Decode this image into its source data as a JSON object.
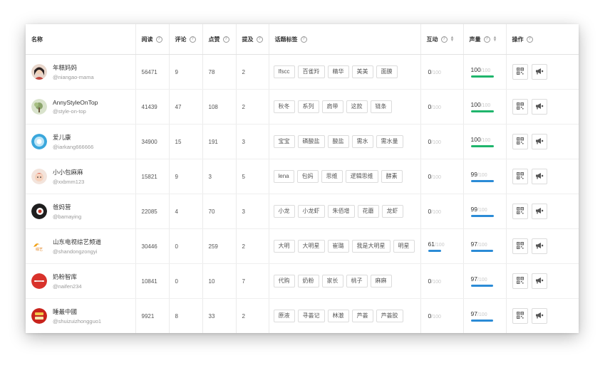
{
  "columns": {
    "name": "名称",
    "reads": "阅读",
    "comments": "评论",
    "likes": "点赞",
    "mentions": "提及",
    "topics": "话题标签",
    "interact": "互动",
    "volume": "声量",
    "actions": "操作"
  },
  "colors": {
    "green": "#1fb56c",
    "blue": "#2b8bd6",
    "help_icon": "question-circle-icon"
  },
  "rows": [
    {
      "name": "年糕妈妈",
      "handle": "@niangao-mama",
      "reads": "56471",
      "comments": "9",
      "likes": "78",
      "mentions": "2",
      "tags": [
        "lfscc",
        "百雀羚",
        "精华",
        "美美",
        "面膜"
      ],
      "interact": {
        "value": "0",
        "of": "/100",
        "fraction": 0
      },
      "volume": {
        "value": "100",
        "of": "/100",
        "fraction": 1.0,
        "color": "green"
      }
    },
    {
      "name": "AnnyStyleOnTop",
      "handle": "@style-on-top",
      "reads": "41439",
      "comments": "47",
      "likes": "108",
      "mentions": "2",
      "tags": [
        "秋冬",
        "系列",
        "肩带",
        "这款",
        "链条"
      ],
      "interact": {
        "value": "0",
        "of": "/100",
        "fraction": 0
      },
      "volume": {
        "value": "100",
        "of": "/100",
        "fraction": 1.0,
        "color": "green"
      }
    },
    {
      "name": "爱儿康",
      "handle": "@iarkang666666",
      "reads": "34900",
      "comments": "15",
      "likes": "191",
      "mentions": "3",
      "tags": [
        "宝宝",
        "磷酸盐",
        "酸盐",
        "需水",
        "需水量"
      ],
      "interact": {
        "value": "0",
        "of": "/100",
        "fraction": 0
      },
      "volume": {
        "value": "100",
        "of": "/100",
        "fraction": 1.0,
        "color": "green"
      }
    },
    {
      "name": "小小包麻麻",
      "handle": "@xxbmm123",
      "reads": "15821",
      "comments": "9",
      "likes": "3",
      "mentions": "5",
      "tags": [
        "lena",
        "包妈",
        "思维",
        "逻辑思维",
        "酵素"
      ],
      "interact": {
        "value": "0",
        "of": "/100",
        "fraction": 0
      },
      "volume": {
        "value": "99",
        "of": "/100",
        "fraction": 0.99,
        "color": "blue"
      }
    },
    {
      "name": "爸妈营",
      "handle": "@bamaying",
      "reads": "22085",
      "comments": "4",
      "likes": "70",
      "mentions": "3",
      "tags": [
        "小龙",
        "小龙虾",
        "朱佰增",
        "花蘑",
        "龙虾"
      ],
      "interact": {
        "value": "0",
        "of": "/100",
        "fraction": 0
      },
      "volume": {
        "value": "99",
        "of": "/100",
        "fraction": 0.99,
        "color": "blue"
      }
    },
    {
      "name": "山东电视综艺频道",
      "handle": "@shandongzongyi",
      "reads": "30446",
      "comments": "0",
      "likes": "259",
      "mentions": "2",
      "tags": [
        "大明",
        "大明星",
        "崔璐",
        "我是大明星",
        "明星"
      ],
      "interact": {
        "value": "61",
        "of": "/100",
        "fraction": 0.61,
        "color": "blue"
      },
      "volume": {
        "value": "97",
        "of": "/100",
        "fraction": 0.97,
        "color": "blue"
      }
    },
    {
      "name": "奶粉智库",
      "handle": "@naifen234",
      "reads": "10841",
      "comments": "0",
      "likes": "10",
      "mentions": "7",
      "tags": [
        "代购",
        "奶粉",
        "家长",
        "桃子",
        "麻麻"
      ],
      "interact": {
        "value": "0",
        "of": "/100",
        "fraction": 0
      },
      "volume": {
        "value": "97",
        "of": "/100",
        "fraction": 0.97,
        "color": "blue"
      }
    },
    {
      "name": "睡最中國",
      "handle": "@shuizuizhongguo1",
      "reads": "9921",
      "comments": "8",
      "likes": "33",
      "mentions": "2",
      "tags": [
        "原液",
        "寻荟记",
        "林澈",
        "芦荟",
        "芦荟胶"
      ],
      "interact": {
        "value": "0",
        "of": "/100",
        "fraction": 0
      },
      "volume": {
        "value": "97",
        "of": "/100",
        "fraction": 0.97,
        "color": "blue"
      }
    }
  ]
}
